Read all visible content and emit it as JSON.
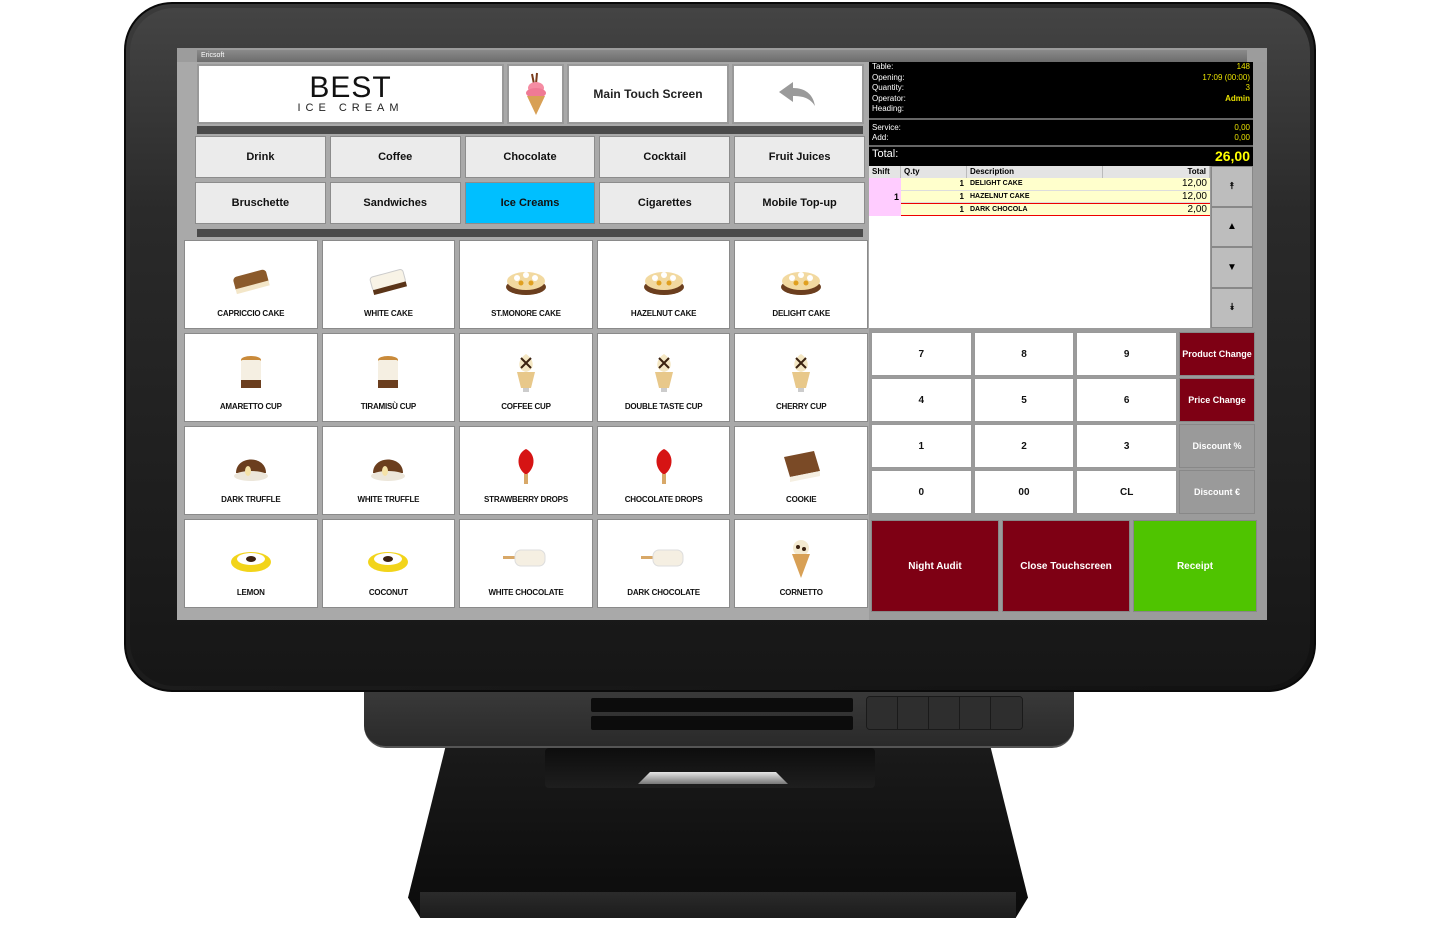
{
  "window": {
    "title": "Ericsoft"
  },
  "header": {
    "logo_big": "BEST",
    "logo_small": "ICE CREAM",
    "screen_title": "Main Touch Screen",
    "back_icon": "undo-arrow-icon",
    "category_icon": "ice-cream-cone-icon"
  },
  "categories": [
    {
      "label": "Drink",
      "active": false
    },
    {
      "label": "Coffee",
      "active": false
    },
    {
      "label": "Chocolate",
      "active": false
    },
    {
      "label": "Cocktail",
      "active": false
    },
    {
      "label": "Fruit Juices",
      "active": false
    },
    {
      "label": "Bruschette",
      "active": false
    },
    {
      "label": "Sandwiches",
      "active": false
    },
    {
      "label": "Ice Creams",
      "active": true
    },
    {
      "label": "Cigarettes",
      "active": false
    },
    {
      "label": "Mobile Top-up",
      "active": false
    }
  ],
  "products": [
    {
      "label": "CAPRICCIO CAKE",
      "icon": "cake-log-icon"
    },
    {
      "label": "WHITE CAKE",
      "icon": "white-cake-icon"
    },
    {
      "label": "ST.MONORE CAKE",
      "icon": "round-cake-icon"
    },
    {
      "label": "HAZELNUT CAKE",
      "icon": "round-cake-icon"
    },
    {
      "label": "DELIGHT CAKE",
      "icon": "round-cake-icon"
    },
    {
      "label": "AMARETTO CUP",
      "icon": "dessert-cup-icon"
    },
    {
      "label": "TIRAMISÙ CUP",
      "icon": "dessert-cup-icon"
    },
    {
      "label": "COFFEE CUP",
      "icon": "sundae-cup-icon"
    },
    {
      "label": "DOUBLE TASTE CUP",
      "icon": "sundae-cup-icon"
    },
    {
      "label": "CHERRY CUP",
      "icon": "sundae-cup-icon"
    },
    {
      "label": "DARK TRUFFLE",
      "icon": "truffle-icon"
    },
    {
      "label": "WHITE TRUFFLE",
      "icon": "truffle-icon"
    },
    {
      "label": "STRAWBERRY DROPS",
      "icon": "popsicle-drop-icon"
    },
    {
      "label": "CHOCOLATE DROPS",
      "icon": "popsicle-drop-icon"
    },
    {
      "label": "COOKIE",
      "icon": "ice-cream-sandwich-icon"
    },
    {
      "label": "LEMON",
      "icon": "stuffed-fruit-icon"
    },
    {
      "label": "COCONUT",
      "icon": "stuffed-fruit-icon"
    },
    {
      "label": "WHITE CHOCOLATE",
      "icon": "ice-cream-bar-icon"
    },
    {
      "label": "DARK CHOCOLATE",
      "icon": "ice-cream-bar-icon"
    },
    {
      "label": "CORNETTO",
      "icon": "cone-icon"
    }
  ],
  "info": {
    "table_label": "Table:",
    "table_value": "148",
    "opening_label": "Opening:",
    "opening_value": "17:09 (00:00)",
    "quantity_label": "Quantity:",
    "quantity_value": "3",
    "operator_label": "Operator:",
    "operator_value": "Admin",
    "heading_label": "Heading:",
    "heading_value": "",
    "service_label": "Service:",
    "service_value": "0,00",
    "add_label": "Add:",
    "add_value": "0,00",
    "total_label": "Total:",
    "total_value": "26,00"
  },
  "order": {
    "columns": [
      "Shift",
      "Q.ty",
      "Description",
      "Total"
    ],
    "shift": "1",
    "lines": [
      {
        "qty": "1",
        "description": "DELIGHT CAKE",
        "total": "12,00",
        "selected": false
      },
      {
        "qty": "1",
        "description": "HAZELNUT CAKE",
        "total": "12,00",
        "selected": false
      },
      {
        "qty": "1",
        "description": "DARK CHOCOLA",
        "total": "2,00",
        "selected": true
      }
    ]
  },
  "scroll": [
    {
      "name": "scroll-top-button",
      "glyph": "⯭",
      "icon": "chevron-double-up-icon"
    },
    {
      "name": "scroll-up-button",
      "glyph": "▲",
      "icon": "triangle-up-icon"
    },
    {
      "name": "scroll-down-button",
      "glyph": "▼",
      "icon": "triangle-down-icon"
    },
    {
      "name": "scroll-bottom-button",
      "glyph": "⯯",
      "icon": "chevron-double-down-icon"
    }
  ],
  "keypad": [
    "7",
    "8",
    "9",
    "4",
    "5",
    "6",
    "1",
    "2",
    "3",
    "0",
    "00",
    "CL"
  ],
  "side_keys": [
    {
      "label": "Product Change",
      "style": "red"
    },
    {
      "label": "Price Change",
      "style": "red"
    },
    {
      "label": "Discount %",
      "style": "grey"
    },
    {
      "label": "Discount €",
      "style": "grey"
    }
  ],
  "actions": [
    {
      "label": "Night Audit",
      "style": "red"
    },
    {
      "label": "Close Touchscreen",
      "style": "red"
    },
    {
      "label": "Receipt",
      "style": "green"
    }
  ],
  "colors": {
    "active_category": "#00bfff",
    "action_red": "#7e0014",
    "receipt_green": "#4fc400",
    "info_value_yellow": "#e8e000",
    "shift_pink": "#ffccff",
    "order_line_bg": "#ffffcc"
  }
}
